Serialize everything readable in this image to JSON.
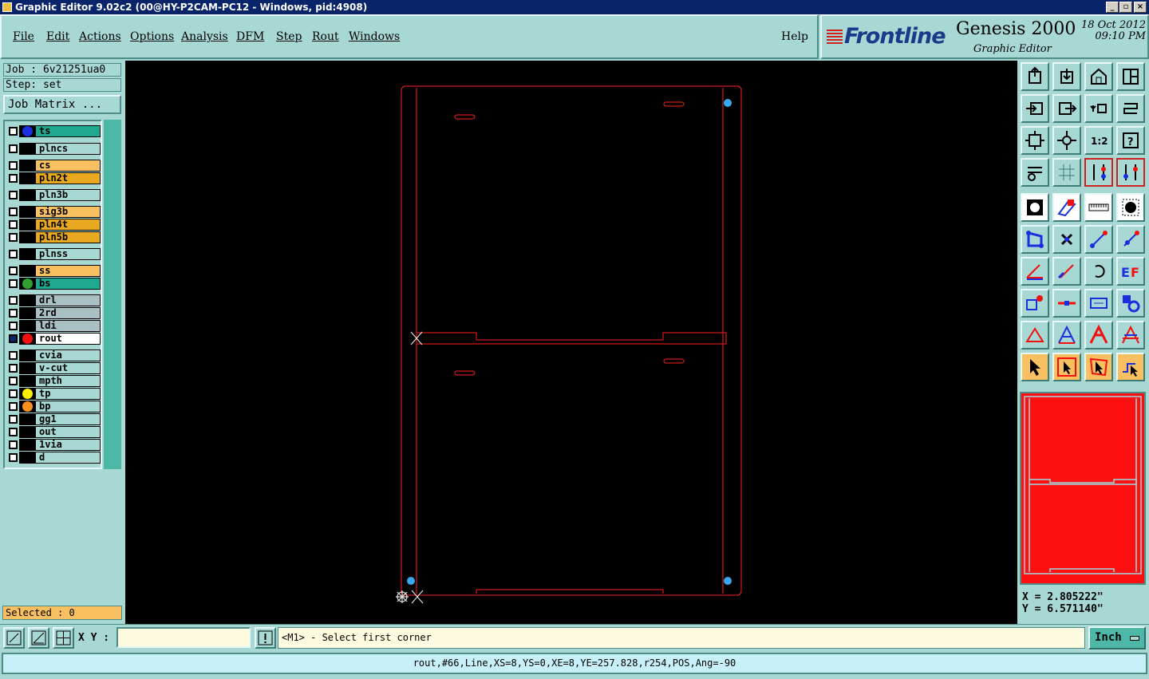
{
  "window": {
    "title": "Graphic Editor 9.02c2 (00@HY-P2CAM-PC12 - Windows, pid:4908)"
  },
  "menu": {
    "items": [
      "File",
      "Edit",
      "Actions",
      "Options",
      "Analysis",
      "DFM",
      "Step",
      "Rout",
      "Windows"
    ],
    "help": "Help"
  },
  "brand": {
    "logo": "Frontline",
    "product": "Genesis 2000",
    "subtitle": "Graphic Editor",
    "date": "18 Oct 2012",
    "time": "09:10 PM"
  },
  "job": {
    "job_line": "Job : 6v21251ua0",
    "step_line": "Step: set",
    "matrix_button": "Job Matrix ..."
  },
  "layers": [
    {
      "name": "ts",
      "bg": "#1ea890",
      "dot": "#1a30e0"
    },
    {
      "name": "plncs",
      "bg": "#a8d8d4",
      "dot": ""
    },
    {
      "name": "cs",
      "bg": "#f8c060",
      "dot": ""
    },
    {
      "name": "pln2t",
      "bg": "#e8a820",
      "dot": ""
    },
    {
      "name": "pln3b",
      "bg": "#a8d8d4",
      "dot": ""
    },
    {
      "name": "sig3b",
      "bg": "#f8c060",
      "dot": ""
    },
    {
      "name": "pln4t",
      "bg": "#e8a820",
      "dot": ""
    },
    {
      "name": "pln5b",
      "bg": "#e8a820",
      "dot": ""
    },
    {
      "name": "plnss",
      "bg": "#a8d8d4",
      "dot": ""
    },
    {
      "name": "ss",
      "bg": "#f8c060",
      "dot": ""
    },
    {
      "name": "bs",
      "bg": "#1ea890",
      "dot": "#30a030"
    },
    {
      "name": "drl",
      "bg": "#a8c0c4",
      "dot": ""
    },
    {
      "name": "2rd",
      "bg": "#a8c0c4",
      "dot": ""
    },
    {
      "name": "ldi",
      "bg": "#a8c0c4",
      "dot": ""
    },
    {
      "name": "rout",
      "bg": "#ffffff",
      "dot": "#f01010"
    },
    {
      "name": "cvia",
      "bg": "#a8d8d4",
      "dot": ""
    },
    {
      "name": "v-cut",
      "bg": "#a8d8d4",
      "dot": ""
    },
    {
      "name": "mpth",
      "bg": "#a8d8d4",
      "dot": ""
    },
    {
      "name": "tp",
      "bg": "#a8d8d4",
      "dot": "#f8f000"
    },
    {
      "name": "bp",
      "bg": "#a8d8d4",
      "dot": "#f89020"
    },
    {
      "name": "gg1",
      "bg": "#a8d8d4",
      "dot": ""
    },
    {
      "name": "out",
      "bg": "#a8d8d4",
      "dot": ""
    },
    {
      "name": "1via",
      "bg": "#a8d8d4",
      "dot": ""
    },
    {
      "name": "d",
      "bg": "#a8d8d4",
      "dot": ""
    }
  ],
  "selected": "Selected : 0",
  "coords": {
    "x": "X = 2.805222\"",
    "y": "Y = 6.571140\""
  },
  "input": {
    "xy_label": "X Y :",
    "xy_value": "",
    "message": "<M1> - Select first corner",
    "unit": "Inch"
  },
  "status": "rout,#66,Line,XS=8,YS=0,XE=8,YE=257.828,r254,POS,Ang=-90",
  "colors": {
    "panel": "#a8d8d4",
    "rout": "#ff2020",
    "pad": "#3aa8f0",
    "preview": "#ff1010"
  }
}
